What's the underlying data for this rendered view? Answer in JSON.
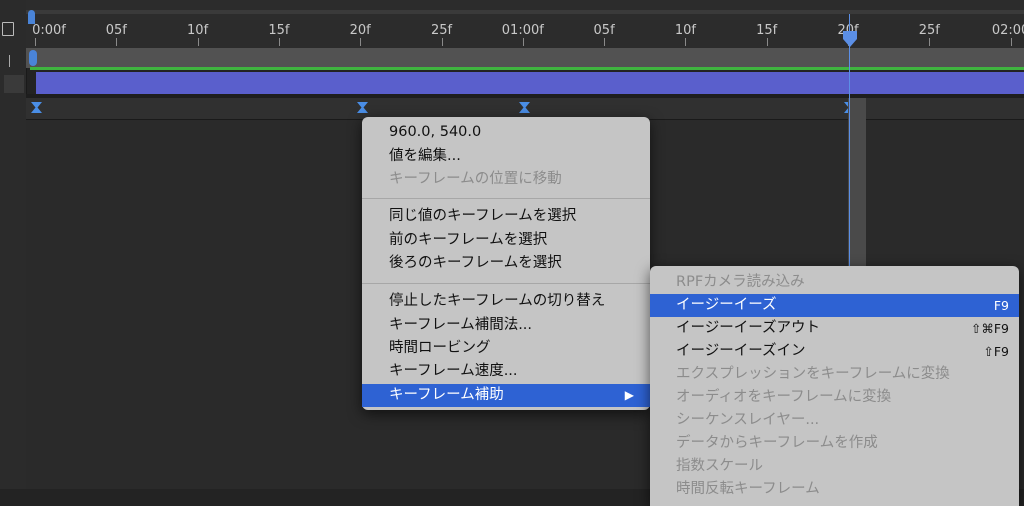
{
  "ruler": {
    "labels": [
      "0:00f",
      "05f",
      "10f",
      "15f",
      "20f",
      "25f",
      "01:00f",
      "05f",
      "10f",
      "15f",
      "20f",
      "25f",
      "02:00"
    ]
  },
  "context_menu": {
    "value_readout": "960.0, 540.0",
    "edit_value": "値を編集...",
    "go_to_keyframe": "キーフレームの位置に移動",
    "select_equal": "同じ値のキーフレームを選択",
    "select_previous": "前のキーフレームを選択",
    "select_following": "後ろのキーフレームを選択",
    "toggle_hold": "停止したキーフレームの切り替え",
    "interpolation": "キーフレーム補間法...",
    "roving": "時間ロービング",
    "velocity": "キーフレーム速度...",
    "assistant": "キーフレーム補助",
    "assistant_arrow": "▶"
  },
  "submenu": {
    "items": [
      {
        "label": "RPFカメラ読み込み",
        "shortcut": "",
        "enabled": false
      },
      {
        "label": "イージーイーズ",
        "shortcut": "F9",
        "enabled": true,
        "selected": true
      },
      {
        "label": "イージーイーズアウト",
        "shortcut": "⇧⌘F9",
        "enabled": true
      },
      {
        "label": "イージーイーズイン",
        "shortcut": "⇧F9",
        "enabled": true
      },
      {
        "label": "エクスプレッションをキーフレームに変換",
        "shortcut": "",
        "enabled": false
      },
      {
        "label": "オーディオをキーフレームに変換",
        "shortcut": "",
        "enabled": false
      },
      {
        "label": "シーケンスレイヤー...",
        "shortcut": "",
        "enabled": false
      },
      {
        "label": "データからキーフレームを作成",
        "shortcut": "",
        "enabled": false
      },
      {
        "label": "指数スケール",
        "shortcut": "",
        "enabled": false
      },
      {
        "label": "時間反転キーフレーム",
        "shortcut": "",
        "enabled": false
      }
    ]
  },
  "colors": {
    "accent": "#2e62d3",
    "layer_bar": "#5a5fcc",
    "cti": "#5b8fe6",
    "green_line": "#3fb43f"
  }
}
